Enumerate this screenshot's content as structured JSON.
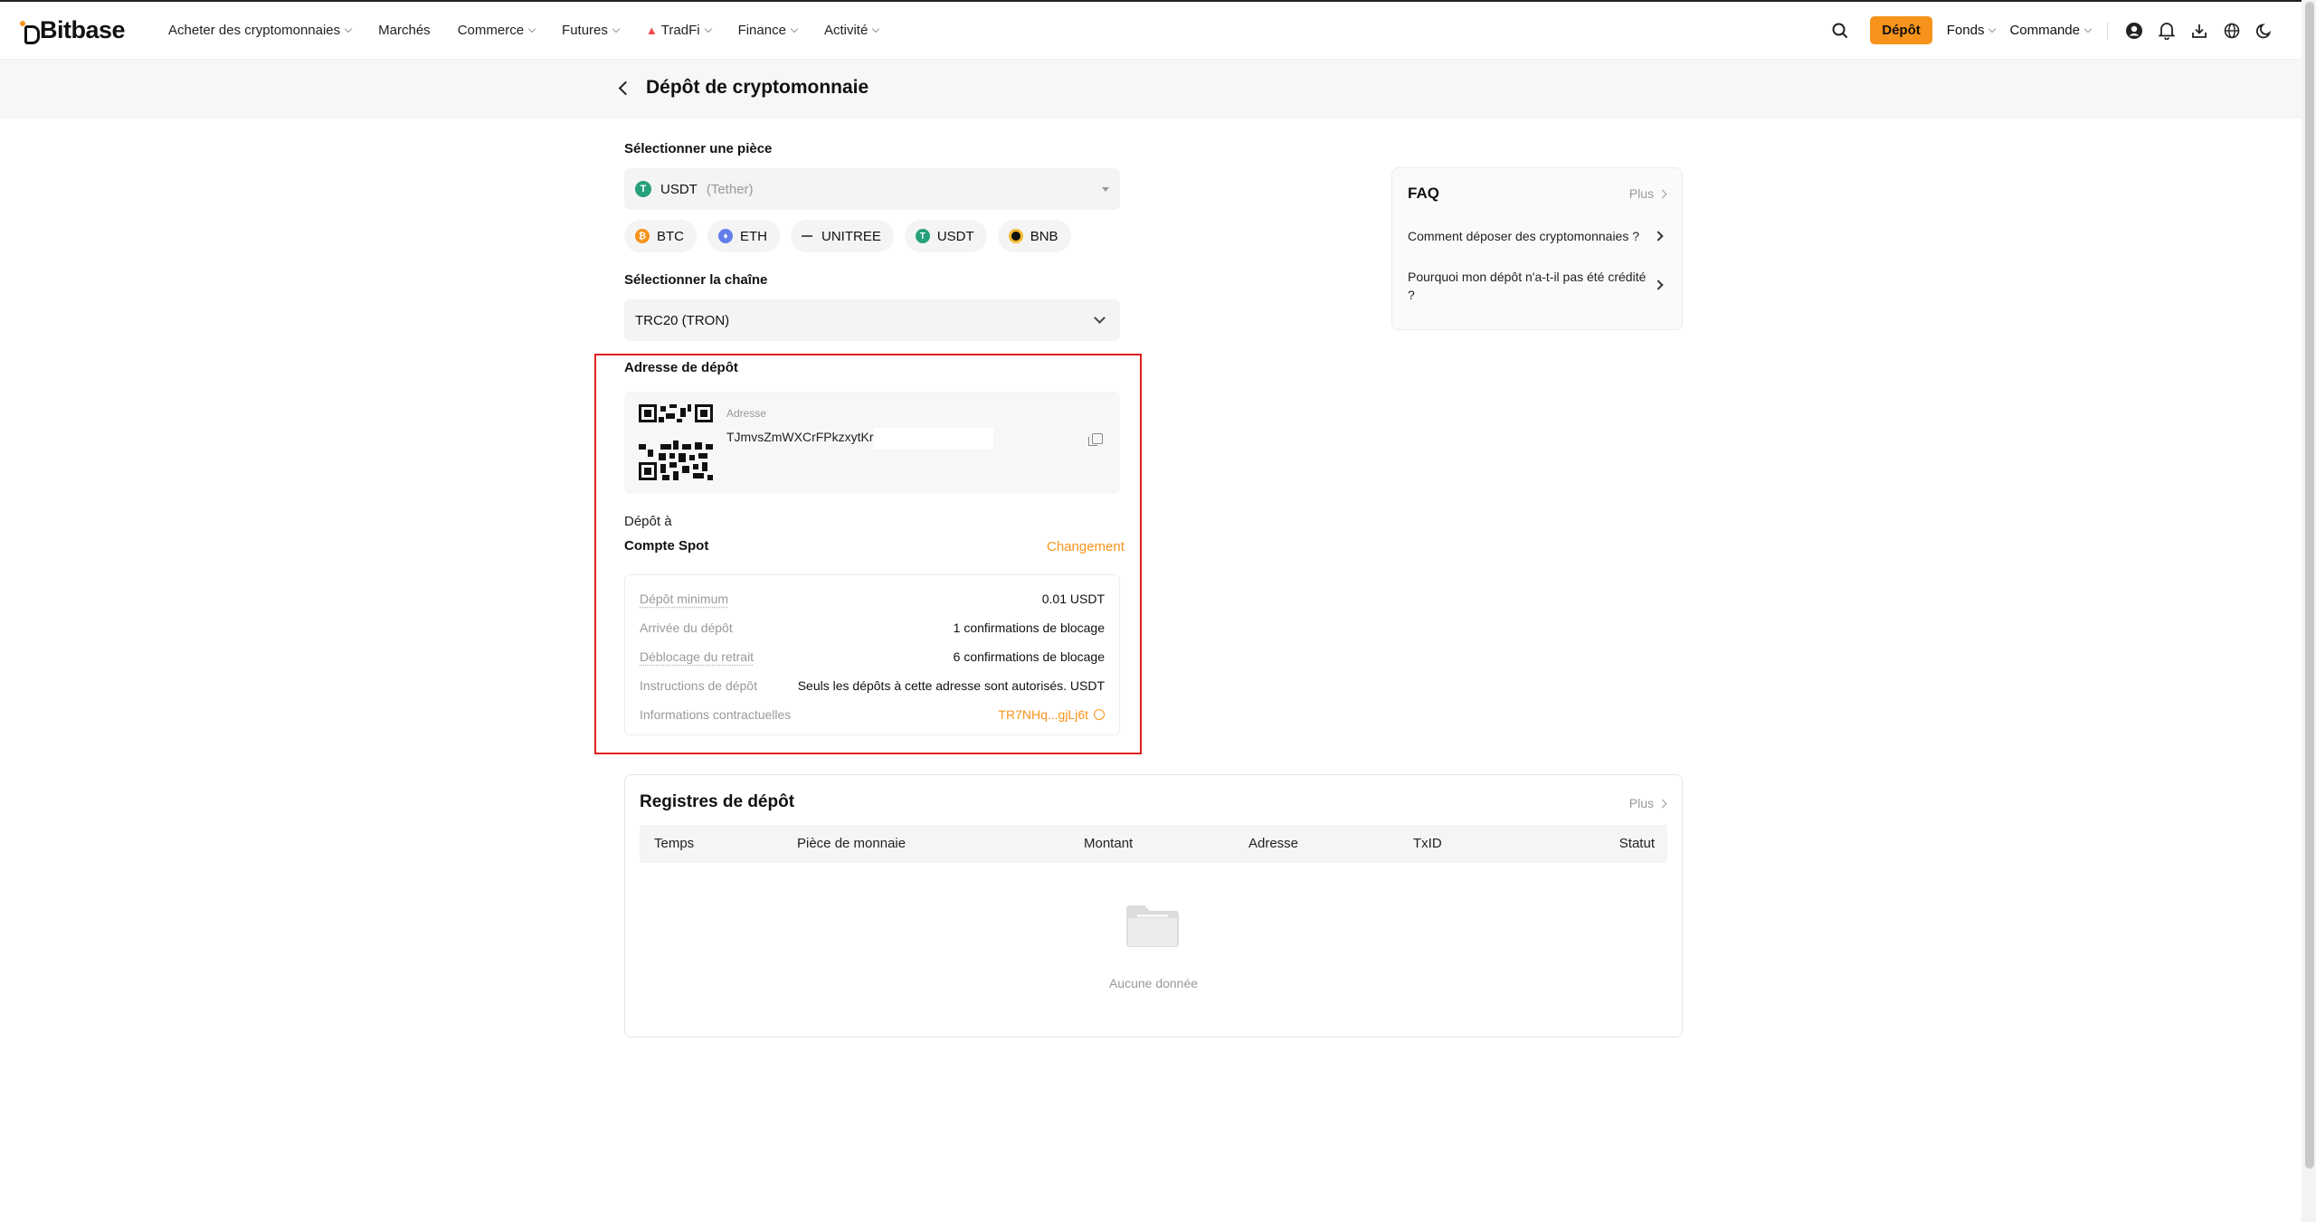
{
  "brand": {
    "name": "Bitbase"
  },
  "nav": {
    "items": [
      {
        "label": "Acheter des cryptomonnaies",
        "dropdown": true
      },
      {
        "label": "Marchés",
        "dropdown": false
      },
      {
        "label": "Commerce",
        "dropdown": true
      },
      {
        "label": "Futures",
        "dropdown": true
      },
      {
        "label": "TradFi",
        "dropdown": true
      },
      {
        "label": "Finance",
        "dropdown": true
      },
      {
        "label": "Activité",
        "dropdown": true
      }
    ],
    "depot_button": "Dépôt",
    "fonds": "Fonds",
    "commande": "Commande"
  },
  "page": {
    "title": "Dépôt de cryptomonnaie"
  },
  "coin_select": {
    "label": "Sélectionner une pièce",
    "symbol": "USDT",
    "name": "(Tether)",
    "quick": [
      "BTC",
      "ETH",
      "UNITREE",
      "USDT",
      "BNB"
    ]
  },
  "chain_select": {
    "label": "Sélectionner la chaîne",
    "value": "TRC20 (TRON)"
  },
  "deposit": {
    "label": "Adresse de dépôt",
    "address_label": "Adresse",
    "address": "TJmvsZmWXCrFPkzxytKr",
    "to_label": "Dépôt à",
    "account": "Compte Spot",
    "change": "Changement",
    "info": [
      {
        "key": "Dépôt minimum",
        "value": "0.01 USDT"
      },
      {
        "key": "Arrivée du dépôt",
        "value": "1 confirmations de blocage"
      },
      {
        "key": "Déblocage du retrait",
        "value": "6 confirmations de blocage"
      },
      {
        "key": "Instructions de dépôt",
        "value": "Seuls les dépôts à cette adresse sont autorisés. USDT"
      },
      {
        "key": "Informations contractuelles",
        "value": "TR7NHq...gjLj6t"
      }
    ]
  },
  "faq": {
    "title": "FAQ",
    "more": "Plus",
    "questions": [
      "Comment déposer des cryptomonnaies ?",
      "Pourquoi mon dépôt n'a-t-il pas été crédité ?"
    ]
  },
  "records": {
    "title": "Registres de dépôt",
    "more": "Plus",
    "columns": [
      "Temps",
      "Pièce de monnaie",
      "Montant",
      "Adresse",
      "TxID",
      "Statut"
    ],
    "empty": "Aucune donnée"
  },
  "colors": {
    "accent": "#f7931a",
    "highlight": "#e02020",
    "usdt": "#26a17b",
    "btc": "#f7931a",
    "eth": "#627eea",
    "bnb": "#f3ba2f"
  }
}
